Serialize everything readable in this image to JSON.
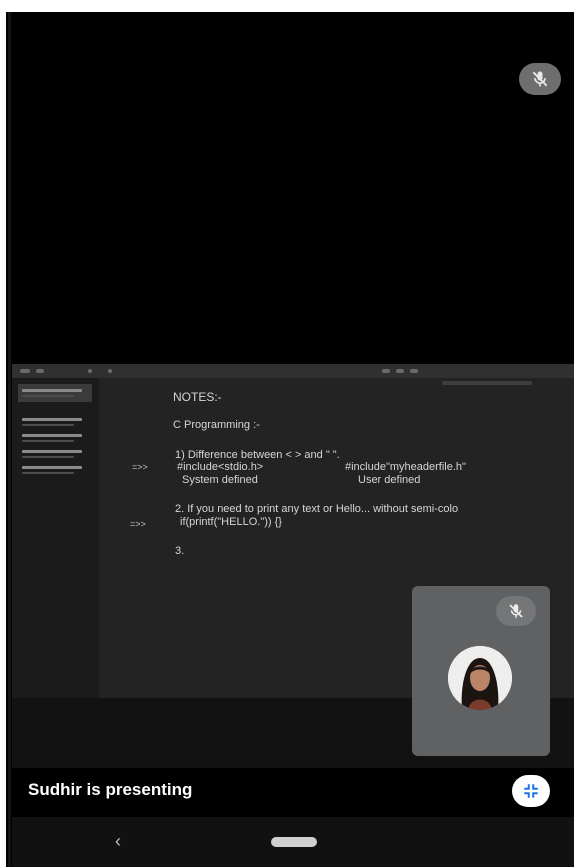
{
  "notes": {
    "heading": "NOTES:-",
    "topic": "C Programming :-",
    "item1": "1) Difference between < > and \" \".",
    "arrow1": "=>>",
    "include1": "#include<stdio.h>",
    "include2": "#include\"myheaderfile.h\"",
    "defined1": "System defined",
    "defined2": "User defined",
    "item2": "2. If you need to print any text or Hello... without semi-colo",
    "arrow2": "=>>",
    "code2": "if(printf(\"HELLO.\")) {}",
    "item3": "3."
  },
  "presenter": {
    "label": "Sudhir is presenting"
  },
  "icons": {
    "top_mic": "mic-off-icon",
    "tile_mic": "mic-off-icon",
    "fullscreen": "exit-fullscreen-icon",
    "back": "back-chevron-icon",
    "home": "home-pill-icon"
  },
  "nav": {
    "back_glyph": "‹"
  },
  "colors": {
    "background": "#000000",
    "shared_screen": "#222322",
    "self_tile": "#606162",
    "accent_blue": "#1a73e8"
  }
}
